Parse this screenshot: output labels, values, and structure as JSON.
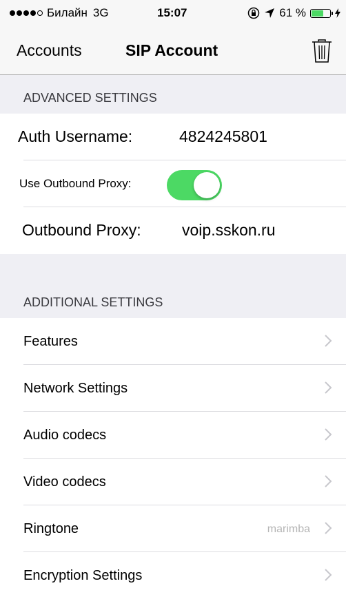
{
  "status_bar": {
    "carrier": "Билайн",
    "network": "3G",
    "time": "15:07",
    "battery": "61 %",
    "battery_level": 0.61,
    "icons": [
      "signal-dots-icon",
      "lock-rotation-icon",
      "location-arrow-icon",
      "battery-icon",
      "charging-bolt-icon"
    ]
  },
  "nav": {
    "back_label": "Accounts",
    "title": "SIP Account",
    "trash_icon": "trash-icon"
  },
  "advanced": {
    "header": "ADVANCED SETTINGS",
    "auth_username_label": "Auth Username:",
    "auth_username_value": "4824245801",
    "use_proxy_label": "Use Outbound Proxy:",
    "use_proxy_on": true,
    "outbound_proxy_label": "Outbound Proxy:",
    "outbound_proxy_value": "voip.sskon.ru"
  },
  "additional": {
    "header": "ADDITIONAL SETTINGS",
    "items": [
      {
        "label": "Features",
        "detail": ""
      },
      {
        "label": "Network Settings",
        "detail": ""
      },
      {
        "label": "Audio codecs",
        "detail": ""
      },
      {
        "label": "Video codecs",
        "detail": ""
      },
      {
        "label": "Ringtone",
        "detail": "marimba"
      },
      {
        "label": "Encryption Settings",
        "detail": ""
      }
    ]
  },
  "colors": {
    "toggle_on": "#4cd964",
    "background": "#efeff4",
    "bar": "#f7f7f7"
  }
}
